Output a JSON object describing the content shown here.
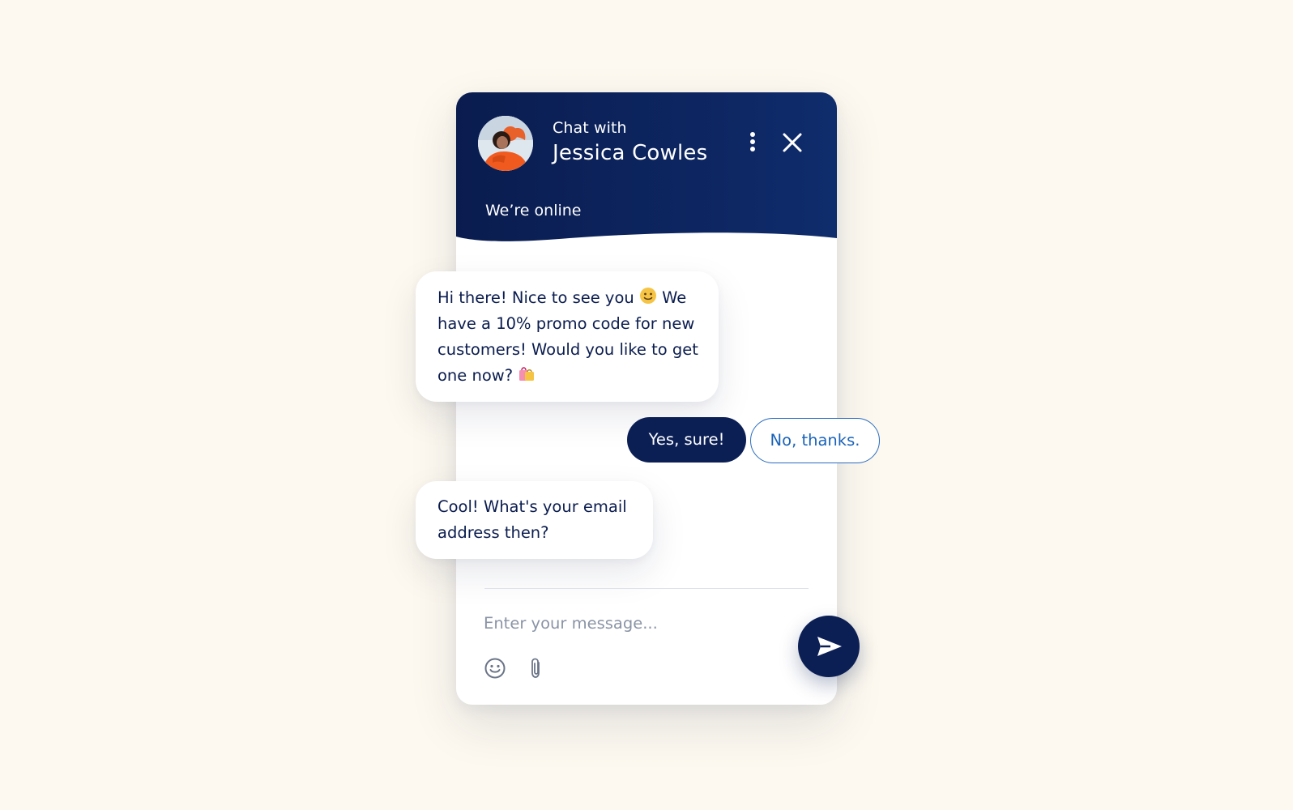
{
  "header": {
    "chat_with_label": "Chat with",
    "agent_name": "Jessica Cowles",
    "status": "We’re online"
  },
  "icons": {
    "menu": "more-vertical-icon",
    "close": "close-icon",
    "emoji": "smiley-icon",
    "attach": "paperclip-icon",
    "send": "send-icon"
  },
  "messages": [
    {
      "text_part1": "Hi there! Nice to see you",
      "text_part2": "We have a 10% promo code for new customers! Would you like to get one now?"
    },
    {
      "text": "Cool! What's your email address then?"
    }
  ],
  "quick_replies": {
    "yes": "Yes, sure!",
    "no": "No, thanks."
  },
  "composer": {
    "placeholder": "Enter your message..."
  },
  "colors": {
    "background": "#fdf9f0",
    "header_navy": "#0b1f55",
    "accent_blue": "#1a63b8",
    "text_navy": "#0b1d4f"
  }
}
